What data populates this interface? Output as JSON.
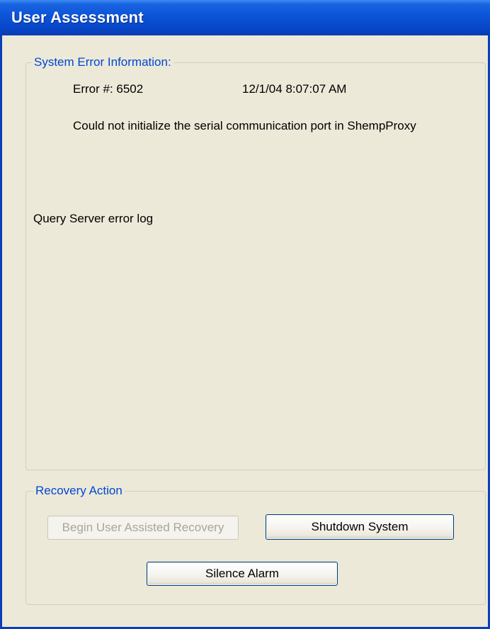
{
  "window": {
    "title": "User Assessment"
  },
  "error_group": {
    "legend": "System Error Information:",
    "error_number": "Error #: 6502",
    "timestamp": "12/1/04 8:07:07 AM",
    "message": "Could not initialize the serial communication port in ShempProxy",
    "log_query": "Query Server error log"
  },
  "recovery_group": {
    "legend": "Recovery Action",
    "begin_recovery_label": "Begin User Assisted Recovery",
    "begin_recovery_enabled": false,
    "shutdown_label": "Shutdown System",
    "silence_alarm_label": "Silence Alarm"
  },
  "colors": {
    "titlebar": "#0a54d8",
    "window_bg": "#ece9d8",
    "groupbox_legend": "#0046d5",
    "disabled_text": "#a9a795"
  }
}
